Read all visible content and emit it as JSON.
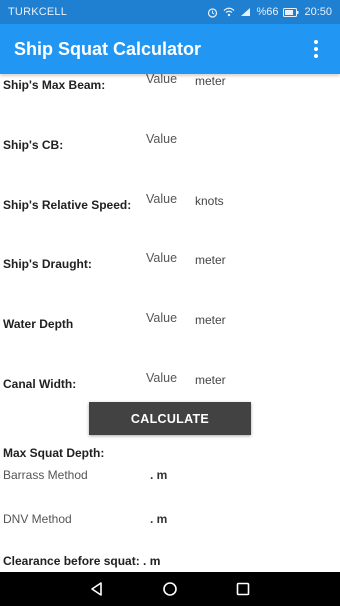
{
  "status_bar": {
    "carrier": "TURKCELL",
    "signal": "%66",
    "time": "20:50"
  },
  "app_bar": {
    "title": "Ship Squat Calculator",
    "menu_icon": "overflow-menu-icon"
  },
  "form": {
    "value_placeholder": "Value",
    "fields": [
      {
        "label": "Ship's Max Beam:",
        "value": "Value",
        "unit": "meter"
      },
      {
        "label": "Ship's CB:",
        "value": "Value",
        "unit": ""
      },
      {
        "label": "Ship's Relative Speed:",
        "value": "Value",
        "unit": "knots"
      },
      {
        "label": "Ship's Draught:",
        "value": "Value",
        "unit": "meter"
      },
      {
        "label": "Water Depth",
        "value": "Value",
        "unit": "meter"
      },
      {
        "label": "Canal Width:",
        "value": "Value",
        "unit": "meter"
      }
    ]
  },
  "calculate_button": "CALCULATE",
  "results": {
    "heading": "Max Squat Depth:",
    "barrass_label": "Barrass Method",
    "barrass_value": ". m",
    "dnv_label": "DNV Method",
    "dnv_value": ". m",
    "clearance": "Clearance before squat: . m"
  },
  "nav_bar": {
    "back": "back-icon",
    "home": "home-icon",
    "recents": "recents-icon"
  },
  "colors": {
    "status_bar": "#1f7fd1",
    "app_bar": "#2196f3",
    "button": "#424242",
    "nav_bar": "#000000"
  }
}
